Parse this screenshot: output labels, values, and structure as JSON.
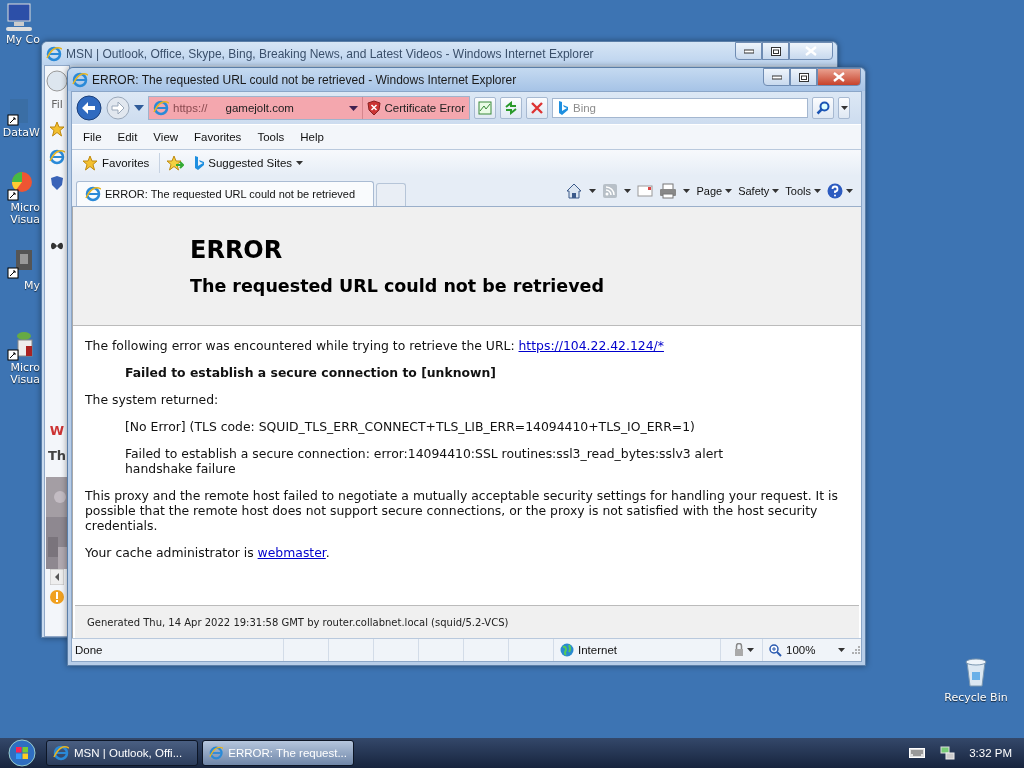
{
  "desktop_icons": [
    {
      "kind": "computer",
      "lines": [
        "My Co"
      ]
    },
    {
      "kind": "shortcut-doc",
      "lines": [
        "DataW"
      ]
    },
    {
      "kind": "shortcut-chart",
      "lines": [
        "Micro",
        "Visua"
      ]
    },
    {
      "kind": "shortcut-face",
      "lines": [
        "My"
      ]
    },
    {
      "kind": "shortcut-leaf",
      "lines": [
        "Micro",
        "Visua"
      ]
    }
  ],
  "recycle_bin": {
    "label": "Recycle Bin"
  },
  "back_window": {
    "title": "MSN | Outlook, Office, Skype, Bing, Breaking News, and Latest Videos - Windows Internet Explorer",
    "menu_fragment": "Fil",
    "headline_fragment": "W",
    "text_fragment": "Th"
  },
  "window": {
    "title": "ERROR: The requested URL could not be retrieved - Windows Internet Explorer",
    "address": {
      "scheme": "https://",
      "host": "gamejolt.com",
      "certificate_error": "Certificate Error"
    },
    "search": {
      "placeholder": "Bing"
    },
    "menu": [
      "File",
      "Edit",
      "View",
      "Favorites",
      "Tools",
      "Help"
    ],
    "favorites_bar": {
      "favorites": "Favorites",
      "suggested": "Suggested Sites"
    },
    "tabs": [
      {
        "label": "ERROR: The requested URL could not be retrieved",
        "selected": true
      }
    ],
    "commands": [
      "Page",
      "Safety",
      "Tools"
    ],
    "page": {
      "heading": "ERROR",
      "subheading": "The requested URL could not be retrieved",
      "blocks": [
        {
          "kind": "para",
          "text": "The following error was encountered while trying to retrieve the URL: ",
          "link": "https://104.22.42.124/*"
        },
        {
          "kind": "strong",
          "text": "Failed to establish a secure connection to [unknown]"
        },
        {
          "kind": "para",
          "text": "The system returned:"
        },
        {
          "kind": "indent",
          "text": "[No Error] (TLS code: SQUID_TLS_ERR_CONNECT+TLS_LIB_ERR=14094410+TLS_IO_ERR=1)"
        },
        {
          "kind": "indent",
          "text": "Failed to establish a secure connection: error:14094410:SSL routines:ssl3_read_bytes:sslv3 alert handshake failure"
        },
        {
          "kind": "para",
          "text": "This proxy and the remote host failed to negotiate a mutually acceptable security settings for handling your request. It is possible that the remote host does not support secure connections, or the proxy is not satisfied with the host security credentials."
        },
        {
          "kind": "para",
          "text": "Your cache administrator is ",
          "link": "webmaster",
          "after": "."
        }
      ],
      "footer": "Generated Thu, 14 Apr 2022 19:31:58 GMT by router.collabnet.local (squid/5.2-VCS)"
    },
    "status_bar": {
      "text": "Done",
      "zone": "Internet",
      "zoom": "100%"
    }
  },
  "taskbar": {
    "buttons": [
      {
        "label": "MSN | Outlook, Offi...",
        "selected": false
      },
      {
        "label": "ERROR: The request...",
        "selected": true
      }
    ],
    "clock": "3:32 PM"
  }
}
